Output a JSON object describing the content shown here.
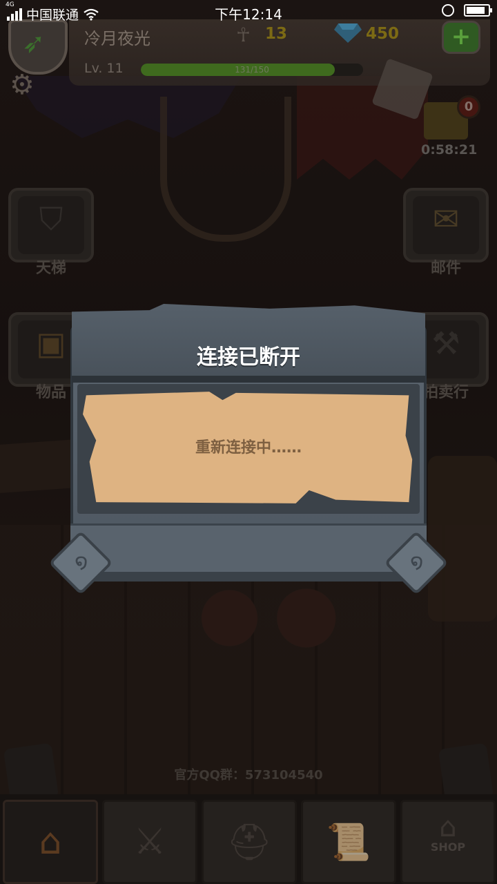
{
  "status_bar": {
    "network_type": "4G",
    "carrier": "中国联通",
    "time": "下午12:14",
    "battery_level": 0.85
  },
  "hud": {
    "player_name": "冷月夜光",
    "ankh_count": "13",
    "gem_count": "450",
    "plus_label": "+",
    "level": "Lv. 11",
    "xp_text": "131/150",
    "xp_fraction": 0.873
  },
  "chest": {
    "badge": "0",
    "timer": "0:58:21"
  },
  "side_buttons": {
    "ladder": "天梯",
    "mail": "邮件",
    "items": "物品",
    "auction": "拍卖行"
  },
  "footer": {
    "qq_group": "官方QQ群：573104540"
  },
  "nav": {
    "tabs": [
      {
        "name": "home",
        "icon": "house-icon",
        "active": true
      },
      {
        "name": "battle",
        "icon": "sword-shield-icon",
        "active": false
      },
      {
        "name": "equipment",
        "icon": "helmet-icon",
        "active": false
      },
      {
        "name": "quests",
        "icon": "scroll-icon",
        "active": false
      },
      {
        "name": "shop",
        "icon": "shop-icon",
        "active": false
      }
    ],
    "shop_label": "SHOP"
  },
  "modal": {
    "title": "连接已断开",
    "message": "重新连接中……"
  },
  "colors": {
    "modal_stone": "#5c6670",
    "parchment": "#deb382",
    "xp_green": "#3f6a1e",
    "gold_text": "#7c6a14"
  }
}
